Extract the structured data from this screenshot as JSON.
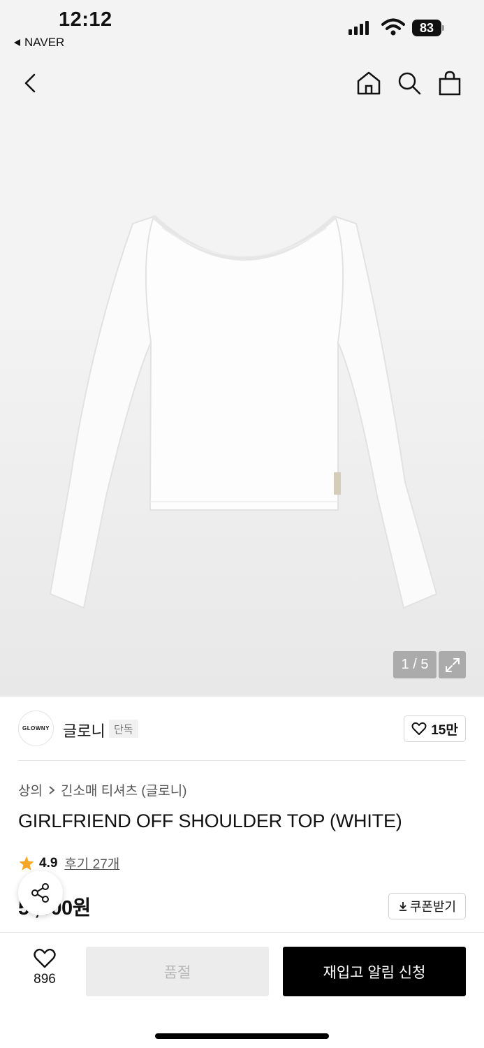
{
  "status_bar": {
    "time": "12:12",
    "back_app": "NAVER",
    "battery": "83"
  },
  "nav": {
    "icons": [
      "back-icon",
      "home-icon",
      "search-icon",
      "shopping-bag-icon"
    ]
  },
  "gallery": {
    "pager": "1 / 5",
    "product_tag_text": "GLOWNY"
  },
  "brand": {
    "logo_text": "GLOWNY",
    "name": "글로니",
    "badge": "단독",
    "likes": "15만"
  },
  "breadcrumb": {
    "category": "상의",
    "subcategory": "긴소매 티셔츠 (글로니)"
  },
  "product": {
    "title": "GIRLFRIEND OFF SHOULDER TOP (WHITE)",
    "rating": "4.9",
    "reviews": "후기 27개",
    "price": "5 ,000원"
  },
  "coupon": {
    "label": "쿠폰받기"
  },
  "bottom_bar": {
    "wish_count": "896",
    "soldout_label": "품절",
    "restock_label": "재입고 알림 신청"
  },
  "colors": {
    "accent_star": "#f5a623",
    "primary_button": "#000000",
    "disabled_button": "#ececec"
  }
}
